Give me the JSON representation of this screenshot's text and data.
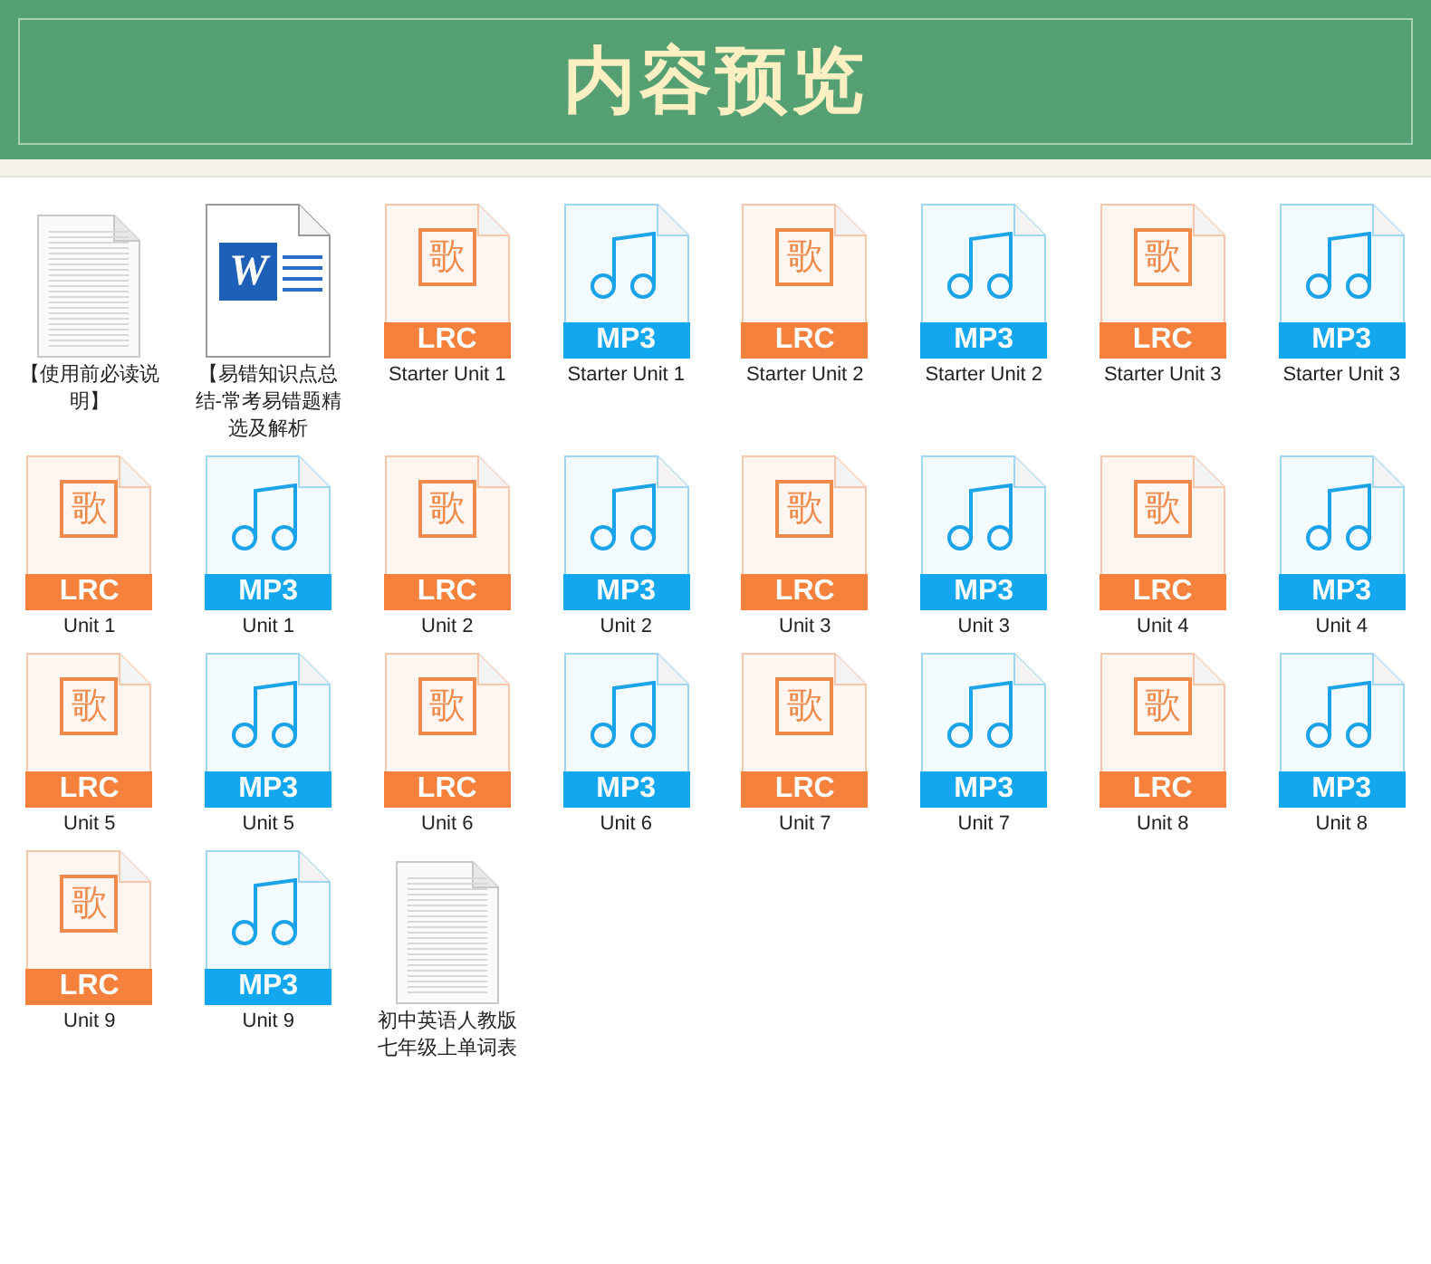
{
  "header": {
    "title": "内容预览"
  },
  "files": [
    {
      "kind": "text",
      "name": "【使用前必读说明】"
    },
    {
      "kind": "word",
      "glyph": "W",
      "name": "【易错知识点总结-常考易错题精选及解析"
    },
    {
      "kind": "lrc",
      "glyph": "歌",
      "badge": "LRC",
      "name": "Starter Unit 1"
    },
    {
      "kind": "mp3",
      "badge": "MP3",
      "name": "Starter Unit 1"
    },
    {
      "kind": "lrc",
      "glyph": "歌",
      "badge": "LRC",
      "name": "Starter Unit 2"
    },
    {
      "kind": "mp3",
      "badge": "MP3",
      "name": "Starter Unit 2"
    },
    {
      "kind": "lrc",
      "glyph": "歌",
      "badge": "LRC",
      "name": "Starter Unit 3"
    },
    {
      "kind": "mp3",
      "badge": "MP3",
      "name": "Starter Unit 3"
    },
    {
      "kind": "lrc",
      "glyph": "歌",
      "badge": "LRC",
      "name": "Unit 1"
    },
    {
      "kind": "mp3",
      "badge": "MP3",
      "name": "Unit 1"
    },
    {
      "kind": "lrc",
      "glyph": "歌",
      "badge": "LRC",
      "name": "Unit 2"
    },
    {
      "kind": "mp3",
      "badge": "MP3",
      "name": "Unit 2"
    },
    {
      "kind": "lrc",
      "glyph": "歌",
      "badge": "LRC",
      "name": "Unit 3"
    },
    {
      "kind": "mp3",
      "badge": "MP3",
      "name": "Unit 3"
    },
    {
      "kind": "lrc",
      "glyph": "歌",
      "badge": "LRC",
      "name": "Unit 4"
    },
    {
      "kind": "mp3",
      "badge": "MP3",
      "name": "Unit 4"
    },
    {
      "kind": "lrc",
      "glyph": "歌",
      "badge": "LRC",
      "name": "Unit 5"
    },
    {
      "kind": "mp3",
      "badge": "MP3",
      "name": "Unit 5"
    },
    {
      "kind": "lrc",
      "glyph": "歌",
      "badge": "LRC",
      "name": "Unit 6"
    },
    {
      "kind": "mp3",
      "badge": "MP3",
      "name": "Unit 6"
    },
    {
      "kind": "lrc",
      "glyph": "歌",
      "badge": "LRC",
      "name": "Unit 7"
    },
    {
      "kind": "mp3",
      "badge": "MP3",
      "name": "Unit 7"
    },
    {
      "kind": "lrc",
      "glyph": "歌",
      "badge": "LRC",
      "name": "Unit 8"
    },
    {
      "kind": "mp3",
      "badge": "MP3",
      "name": "Unit 8"
    },
    {
      "kind": "lrc",
      "glyph": "歌",
      "badge": "LRC",
      "name": "Unit 9"
    },
    {
      "kind": "mp3",
      "badge": "MP3",
      "name": "Unit 9"
    },
    {
      "kind": "text",
      "name": "初中英语人教版七年级上单词表"
    }
  ]
}
